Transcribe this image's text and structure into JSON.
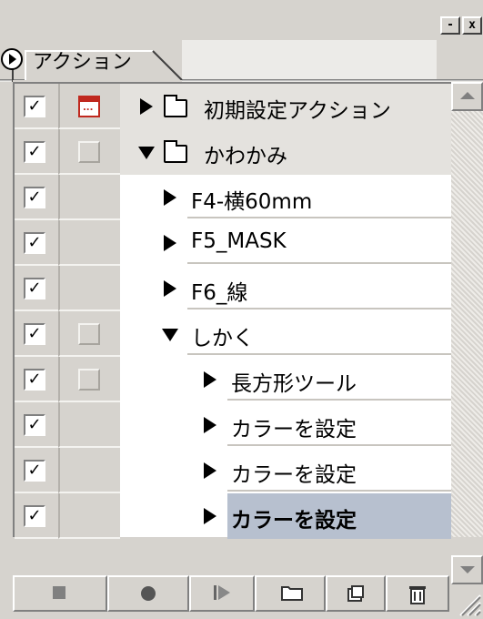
{
  "window": {
    "minimize_glyph": "-",
    "close_glyph": "x"
  },
  "tabs": [
    {
      "label": "アクション",
      "active": true
    }
  ],
  "actions_list": {
    "rows": [
      {
        "type": "set",
        "label": "初期設定アクション",
        "expanded": false,
        "checked": true,
        "dialog": "modal-icon",
        "indent": 0,
        "selected": false
      },
      {
        "type": "set",
        "label": "かわかみ",
        "expanded": true,
        "checked": true,
        "dialog": "empty-box",
        "indent": 0,
        "selected": false
      },
      {
        "type": "action",
        "label": "F4-横60mm",
        "expanded": false,
        "checked": true,
        "dialog": "none",
        "indent": 1,
        "selected": false
      },
      {
        "type": "action",
        "label": "F5_MASK",
        "expanded": false,
        "checked": true,
        "dialog": "none",
        "indent": 1,
        "selected": false
      },
      {
        "type": "action",
        "label": "F6_線",
        "expanded": false,
        "checked": true,
        "dialog": "none",
        "indent": 1,
        "selected": false
      },
      {
        "type": "action",
        "label": "しかく",
        "expanded": true,
        "checked": true,
        "dialog": "empty-box",
        "indent": 1,
        "selected": false
      },
      {
        "type": "command",
        "label": "長方形ツール",
        "expanded": false,
        "checked": true,
        "dialog": "empty-box",
        "indent": 2,
        "selected": false
      },
      {
        "type": "command",
        "label": "カラーを設定",
        "expanded": false,
        "checked": true,
        "dialog": "none",
        "indent": 2,
        "selected": false
      },
      {
        "type": "command",
        "label": "カラーを設定",
        "expanded": false,
        "checked": true,
        "dialog": "none",
        "indent": 2,
        "selected": false
      },
      {
        "type": "command",
        "label": "カラーを設定",
        "expanded": false,
        "checked": true,
        "dialog": "none",
        "indent": 2,
        "selected": true
      }
    ],
    "check_glyph": "✓"
  },
  "toolbar": {
    "buttons": [
      {
        "name": "stop-button",
        "icon": "stop-icon"
      },
      {
        "name": "record-button",
        "icon": "record-icon"
      },
      {
        "name": "play-button",
        "icon": "play-icon"
      },
      {
        "name": "new-set-button",
        "icon": "folder-icon"
      },
      {
        "name": "new-action-button",
        "icon": "new-action-icon"
      },
      {
        "name": "delete-button",
        "icon": "trash-icon"
      }
    ]
  },
  "colors": {
    "panel_bg": "#d6d3ce",
    "list_bg": "#ffffff",
    "selection_bg": "#b7c0cf",
    "set_row_bg": "#e4e2de",
    "dialog_icon_red": "#c0281e"
  }
}
